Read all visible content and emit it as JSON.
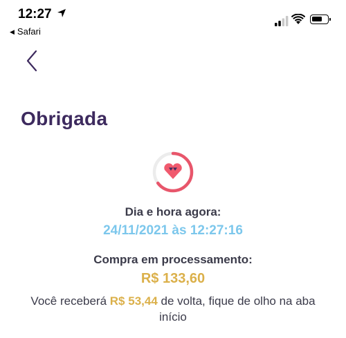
{
  "status_bar": {
    "time": "12:27",
    "back_app": "Safari",
    "icons": [
      "location-arrow-icon",
      "cellular-signal-icon",
      "wifi-icon",
      "battery-icon"
    ]
  },
  "nav": {
    "back_icon": "chevron-left-icon"
  },
  "page": {
    "title": "Obrigada"
  },
  "progress_icon": {
    "icon": "heart-diamond-icon",
    "colors": {
      "ring": "#e8566b",
      "track": "#ececec",
      "heart": "#f05a6e",
      "accent": "#3d2a5e"
    }
  },
  "datetime": {
    "label": "Dia e hora agora:",
    "value": "24/11/2021 às 12:27:16"
  },
  "purchase": {
    "label": "Compra em processamento:",
    "amount": "R$ 133,60"
  },
  "cashback": {
    "prefix": "Você receberá ",
    "amount": "R$ 53,44",
    "suffix": " de volta, fique de olho na aba início"
  },
  "colors": {
    "title": "#3d2a5e",
    "date": "#7cc7ec",
    "amount": "#dbb04a",
    "text": "#3b3b4a"
  }
}
